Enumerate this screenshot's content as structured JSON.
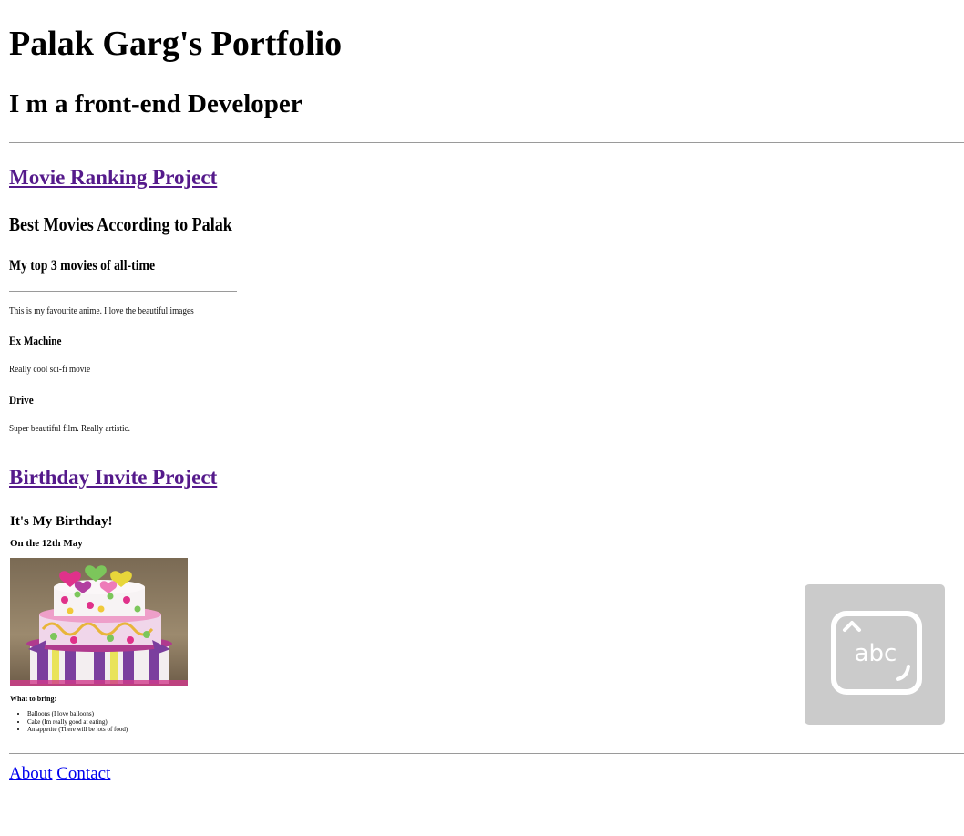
{
  "header": {
    "title": "Palak Garg's Portfolio",
    "subtitle": "I m a front-end Developer"
  },
  "projects": {
    "movie": {
      "link_label": "Movie Ranking Project",
      "heading": "Best Movies According to Palak",
      "subheading": "My top 3 movies of all-time",
      "intro": "This is my favourite anime. I love the beautiful images",
      "items": [
        {
          "title": "Ex Machine",
          "desc": "Really cool sci-fi movie"
        },
        {
          "title": "Drive",
          "desc": "Super beautiful film. Really artistic."
        }
      ]
    },
    "birthday": {
      "link_label": "Birthday Invite Project",
      "heading": "It's My Birthday!",
      "date": "On the 12th May",
      "bring_heading": "What to bring:",
      "bring_items": [
        "Balloons (I love balloons)",
        "Cake (Im really good at eating)",
        "An appetite (There will be lots of food)"
      ]
    }
  },
  "footer": {
    "about_label": "About",
    "contact_label": "Contact"
  },
  "keyboard_widget": {
    "label": "abc",
    "icon": "keyboard-abc-icon"
  },
  "colors": {
    "visited_link": "#551a8b",
    "link": "#0000ee",
    "widget_bg": "#cbcbcb"
  }
}
